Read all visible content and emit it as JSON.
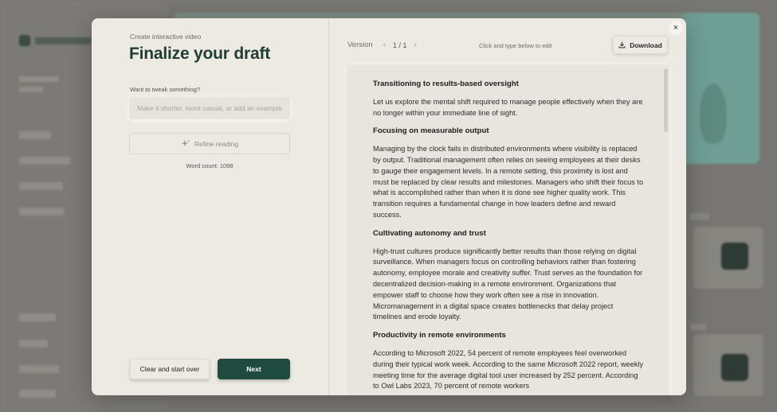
{
  "modal": {
    "subtitle": "Create interactive video",
    "title": "Finalize your draft",
    "tweak_label": "Want to tweak something?",
    "tweak_placeholder": "Make it shorter, more casual, or add an example",
    "refine_label": "Refine reading",
    "word_count": "Word count: 1098",
    "clear_label": "Clear and start over",
    "next_label": "Next"
  },
  "toolbar": {
    "version_label": "Version",
    "version_page": "1 / 1",
    "hint": "Click and type below to edit",
    "download_label": "Download",
    "close_glyph": "×"
  },
  "document": {
    "sections": [
      {
        "heading": "Transitioning to results-based oversight",
        "body": "Let us explore the mental shift required to manage people effectively when they are no longer within your immediate line of sight."
      },
      {
        "heading": "Focusing on measurable output",
        "body": "Managing by the clock fails in distributed environments where visibility is replaced by output. Traditional management often relies on seeing employees at their desks to gauge their engagement levels. In a remote setting, this proximity is lost and must be replaced by clear results and milestones. Managers who shift their focus to what is accomplished rather than when it is done see higher quality work. This transition requires a fundamental change in how leaders define and reward success."
      },
      {
        "heading": "Cultivating autonomy and trust",
        "body": "High-trust cultures produce significantly better results than those relying on digital surveillance. When managers focus on controlling behaviors rather than fostering autonomy, employee morale and creativity suffer. Trust serves as the foundation for decentralized decision-making in a remote environment. Organizations that empower staff to choose how they work often see a rise in innovation. Micromanagement in a digital space creates bottlenecks that delay project timelines and erode loyalty."
      },
      {
        "heading": "Productivity in remote environments",
        "body": "According to Microsoft 2022, 54 percent of remote employees feel overworked during their typical work week. According to the same Microsoft 2022 report, weekly meeting time for the average digital tool user increased by 252 percent. According to Owl Labs 2023, 70 percent of remote workers"
      }
    ]
  },
  "icons": {
    "refine": "sparkle-icon",
    "download": "download-icon",
    "prev": "chevron-left-icon",
    "next": "chevron-right-icon",
    "close": "close-icon"
  },
  "colors": {
    "accent": "#1f4a3f",
    "title": "#1f3d34",
    "modal_bg": "#edeae3"
  }
}
